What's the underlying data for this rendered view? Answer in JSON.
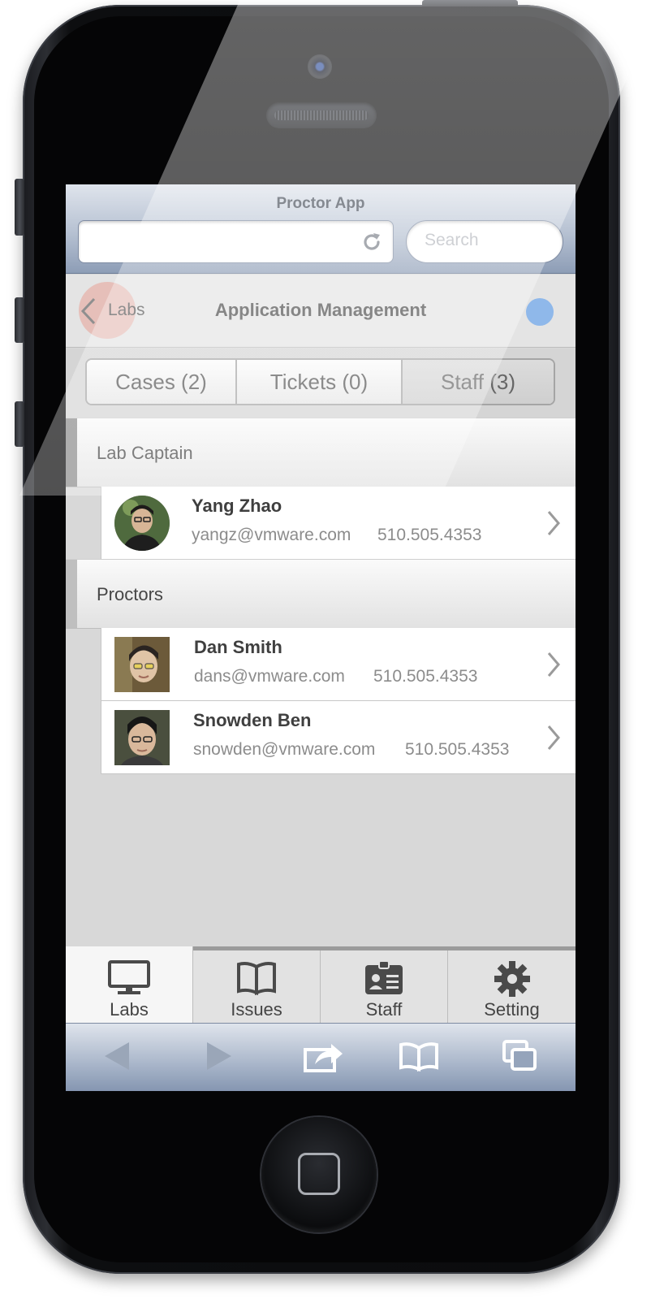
{
  "browser": {
    "title": "Proctor App",
    "search_placeholder": "Search"
  },
  "nav": {
    "back_label": "Labs",
    "title": "Application Management",
    "status_color": "#8fb8ea"
  },
  "segments": [
    {
      "label": "Cases (2)",
      "active": false
    },
    {
      "label": "Tickets (0)",
      "active": false
    },
    {
      "label": "Staff (3)",
      "active": true
    }
  ],
  "sections": [
    {
      "header": "Lab Captain",
      "people": [
        {
          "name": "Yang Zhao",
          "email": "yangz@vmware.com",
          "phone": "510.505.4353",
          "avatar": "round-photo"
        }
      ]
    },
    {
      "header": "Proctors",
      "people": [
        {
          "name": "Dan Smith",
          "email": "dans@vmware.com",
          "phone": "510.505.4353",
          "avatar": "square-photo"
        },
        {
          "name": "Snowden Ben",
          "email": "snowden@vmware.com",
          "phone": "510.505.4353",
          "avatar": "square-photo"
        }
      ]
    }
  ],
  "tabbar": [
    {
      "label": "Labs",
      "icon": "monitor-icon",
      "active": true
    },
    {
      "label": "Issues",
      "icon": "book-icon",
      "active": false
    },
    {
      "label": "Staff",
      "icon": "id-badge-icon",
      "active": false
    },
    {
      "label": "Setting",
      "icon": "gear-icon",
      "active": false
    }
  ],
  "browser_toolbar": [
    "back-arrow-icon",
    "forward-arrow-icon",
    "share-icon",
    "bookmarks-icon",
    "tabs-icon"
  ]
}
